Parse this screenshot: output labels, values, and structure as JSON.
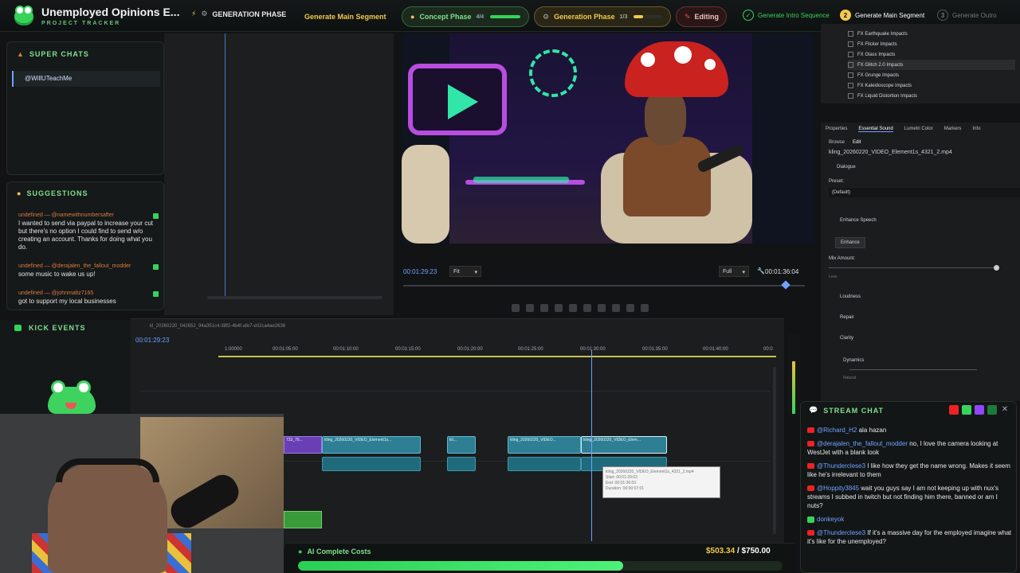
{
  "header": {
    "title": "Unemployed Opinions E...",
    "subtitle": "PROJECT TRACKER",
    "generation_phase_label": "GENERATION PHASE",
    "generate_main_segment": "Generate Main Segment",
    "phases": [
      {
        "label": "Concept Phase",
        "count": "4/4",
        "progress": 1.0,
        "color": "#36d35b"
      },
      {
        "label": "Generation Phase",
        "count": "1/3",
        "progress": 0.33,
        "color": "#f2c94c"
      },
      {
        "label": "Editing",
        "count": "",
        "progress": 0,
        "color": "#e24d4d"
      }
    ],
    "steps": [
      {
        "num": "✓",
        "label": "Generate Intro Sequence",
        "state": "done"
      },
      {
        "num": "2",
        "label": "Generate Main Segment",
        "state": "active"
      },
      {
        "num": "3",
        "label": "Generate Outro",
        "state": "pending"
      }
    ]
  },
  "super_chats": {
    "title": "SUPER CHATS",
    "items": [
      "@WillUTeachMe"
    ]
  },
  "suggestions": {
    "title": "SUGGESTIONS",
    "items": [
      {
        "user": "undefined — @namewithnumbersafter",
        "text": "I wanted to send via paypal to increase your cut but there's no option I could find to send w/o creating an account. Thanks for doing what you do."
      },
      {
        "user": "undefined — @derajalen_the_fallout_modder",
        "text": "some music to wake us up!"
      },
      {
        "user": "undefined — @johnmaltz7165",
        "text": "got to support my local businesses"
      }
    ]
  },
  "kick_events": {
    "title": "KICK EVENTS"
  },
  "monitor": {
    "timecode_current": "00:01:29:23",
    "fit_label": "Fit",
    "full_label": "Full",
    "timecode_total": "00:01:36:04"
  },
  "timeline": {
    "sequence_name": "kl_20260220_042652_94a351c4-38f2-4b4f-afe7-e02ca4ae2636",
    "timecode": "00:01:29:23",
    "ruler": [
      "1:00000",
      "00:01:05:00",
      "00:01:10:00",
      "00:01:15:00",
      "00:01:20:00",
      "00:01:25:00",
      "00:01:30:00",
      "00:01:35:00",
      "00:01:40:00",
      "00:0"
    ],
    "clips": [
      {
        "label": "733_76..."
      },
      {
        "label": "kling_20260220_VIDEO_Element1s..."
      },
      {
        "label": "kli..."
      },
      {
        "label": "kling_20260220_VIDEO..."
      },
      {
        "label": "kling_20260220_VIDEO_Elem..."
      }
    ],
    "tooltip": {
      "name": "kling_20260220_VIDEO_Element1s_4321_2.mp4",
      "start": "Start: 00:01:29:03",
      "end": "End: 00:01:36:03",
      "duration": "Duration: 00:00:07:01"
    }
  },
  "effects": {
    "items": [
      "FX Earthquake Impacts",
      "FX Flicker Impacts",
      "FX Glass Impacts",
      "FX Glitch 2.0 Impacts",
      "FX Grunge Impacts",
      "FX Kaleidoscope Impacts",
      "FX Liquid Distortion Impacts"
    ]
  },
  "essential_sound": {
    "tabs": [
      "Properties",
      "Essential Sound",
      "Lumetri Color",
      "Markers",
      "Info"
    ],
    "subtabs": [
      "Browse",
      "Edit"
    ],
    "clip_name": "kling_20260220_VIDEO_Element1s_4321_2.mp4",
    "type": "Dialogue",
    "preset_label": "Preset:",
    "preset_value": "(Default)",
    "enhance_speech": "Enhance Speech",
    "enhance_button": "Enhance",
    "mix_amount": "Mix Amount:",
    "less": "Less",
    "sections": [
      "Loudness",
      "Repair",
      "Clarity"
    ],
    "dynamics": "Dynamics",
    "natural": "Natural"
  },
  "stream_chat": {
    "title": "STREAM CHAT",
    "messages": [
      {
        "platform": "yt",
        "user": "@Richard_H2",
        "text": "ala hazan"
      },
      {
        "platform": "yt",
        "user": "@derajalen_the_fallout_modder",
        "text": "no, I love the camera looking at WestJet with a blank look"
      },
      {
        "platform": "yt",
        "user": "@Thunderclese3",
        "text": "I like how they get the name wrong. Makes it seem like he's irrelevant to them"
      },
      {
        "platform": "yt",
        "user": "@Hoppity3845",
        "text": "wait you guys say I am not keeping up with nux's streams I subbed in twitch but not finding him there, banned or am I nuts?"
      },
      {
        "platform": "kick",
        "user": "donkeyok",
        "text": ""
      },
      {
        "platform": "yt",
        "user": "@Thunderclese3",
        "text": "If it's a massive day for the employed imagine what it's like for the unemployed?"
      }
    ]
  },
  "costs": {
    "label": "AI Complete Costs",
    "spent": "$503.34",
    "budget": "/ $750.00",
    "fraction": 0.671
  }
}
